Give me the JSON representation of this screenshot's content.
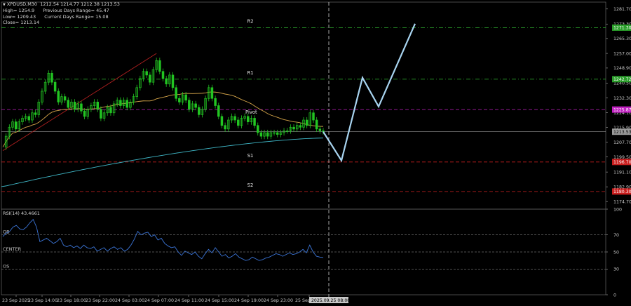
{
  "info": {
    "title": "XPDUSD,M30",
    "ohlc_line": "1212.54 1214.77 1212.38 1213.53",
    "high": "High= 1254.9",
    "prev_range": "Previous Days Range= 45.47",
    "low": "Low= 1209.43",
    "cur_range": "Current Days Range= 15.08",
    "close": "Close= 1213.14"
  },
  "rsi_label": "RSI(14) 43.4661",
  "colors": {
    "background": "#000000",
    "grid": "#2e2e2e",
    "candle": "#22c522",
    "zigzag": "#b22020",
    "ma_slow": "#d7a64a",
    "ma_long": "#3fb8c8",
    "rsi": "#3b74d6",
    "forecast": "#a8d4f0",
    "resistance": "#2a9e2a",
    "pivot": "#c020c0",
    "support": "#c81e1e"
  },
  "chart_data": {
    "type": "candlestick",
    "symbol": "XPDUSD",
    "timeframe": "M30",
    "ylim": [
      1170.5,
      1285.5
    ],
    "y_ticks": [
      "1281.70",
      "1273.30",
      "1265.30",
      "1257.00",
      "1248.90",
      "1240.50",
      "1232.30",
      "1224.10",
      "1215.90",
      "1207.70",
      "1199.50",
      "1191.10",
      "1182.90",
      "1174.70"
    ],
    "levels": [
      {
        "label": "R2",
        "value": 1271.3,
        "tag": "1271.30",
        "kind": "resistance"
      },
      {
        "label": "R1",
        "value": 1242.7,
        "tag": "1242.72",
        "kind": "resistance"
      },
      {
        "label": "Pivot",
        "value": 1225.8,
        "tag": "1225.87",
        "kind": "pivot"
      },
      {
        "label": "S1",
        "value": 1196.7,
        "tag": "1196.70",
        "kind": "support"
      },
      {
        "label": "S2",
        "value": 1180.3,
        "tag": "1180.30",
        "kind": "support"
      }
    ],
    "current_price": {
      "value": 1213.5,
      "tag": "1213.53"
    },
    "x_labels": [
      "23 Sep 2025",
      "23 Sep 14:00",
      "23 Sep 18:00",
      "23 Sep 22:00",
      "24 Sep 03:00",
      "24 Sep 07:00",
      "24 Sep 11:00",
      "24 Sep 15:00",
      "24 Sep 19:00",
      "24 Sep 23:00",
      "25 Sep"
    ],
    "x_current_label": "2025.09.25 08:00",
    "closes": [
      1205,
      1211,
      1216,
      1219,
      1215,
      1219,
      1221,
      1222,
      1220,
      1224,
      1223,
      1230,
      1236,
      1241,
      1246,
      1241,
      1236,
      1230,
      1233,
      1231,
      1227,
      1230,
      1226,
      1229,
      1225,
      1222,
      1226,
      1228,
      1230,
      1226,
      1221,
      1224,
      1227,
      1224,
      1229,
      1231,
      1228,
      1231,
      1227,
      1230,
      1233,
      1238,
      1243,
      1247,
      1245,
      1241,
      1248,
      1253,
      1247,
      1243,
      1240,
      1245,
      1238,
      1232,
      1230,
      1234,
      1231,
      1226,
      1229,
      1227,
      1223,
      1226,
      1232,
      1238,
      1232,
      1228,
      1222,
      1217,
      1215,
      1220,
      1222,
      1220,
      1217,
      1221,
      1222,
      1219,
      1221,
      1217,
      1213,
      1211,
      1213,
      1211,
      1213,
      1213,
      1212,
      1213,
      1214,
      1214,
      1216,
      1215,
      1217,
      1216,
      1220,
      1217,
      1224,
      1220,
      1215,
      1214,
      1213.5
    ],
    "forecast": [
      1213.5,
      1197.5,
      1243.5,
      1227.5,
      1273.5
    ],
    "rsi": {
      "ylim": [
        0,
        100
      ],
      "y_ticks": [
        100,
        70,
        50,
        30,
        0
      ],
      "levels": [
        {
          "label": "OB",
          "value": 70
        },
        {
          "label": "CENTER",
          "value": 50
        },
        {
          "label": "OS",
          "value": 30
        }
      ],
      "values": [
        68,
        72,
        74,
        79,
        81,
        77,
        76,
        79,
        84,
        88,
        79,
        62,
        64,
        66,
        63,
        60,
        62,
        66,
        58,
        56,
        58,
        55,
        57,
        54,
        58,
        55,
        54,
        56,
        51,
        53,
        55,
        51,
        54,
        56,
        53,
        55,
        51,
        53,
        58,
        65,
        74,
        70,
        72,
        73,
        68,
        70,
        64,
        66,
        60,
        57,
        55,
        56,
        50,
        46,
        51,
        49,
        47,
        50,
        45,
        42,
        48,
        53,
        49,
        55,
        50,
        45,
        47,
        43,
        45,
        48,
        44,
        42,
        40,
        41,
        44,
        42,
        40,
        41,
        43,
        44,
        46,
        48,
        47,
        45,
        47,
        49,
        47,
        48,
        50,
        53,
        49,
        58,
        50,
        45,
        44,
        43.5
      ]
    }
  }
}
